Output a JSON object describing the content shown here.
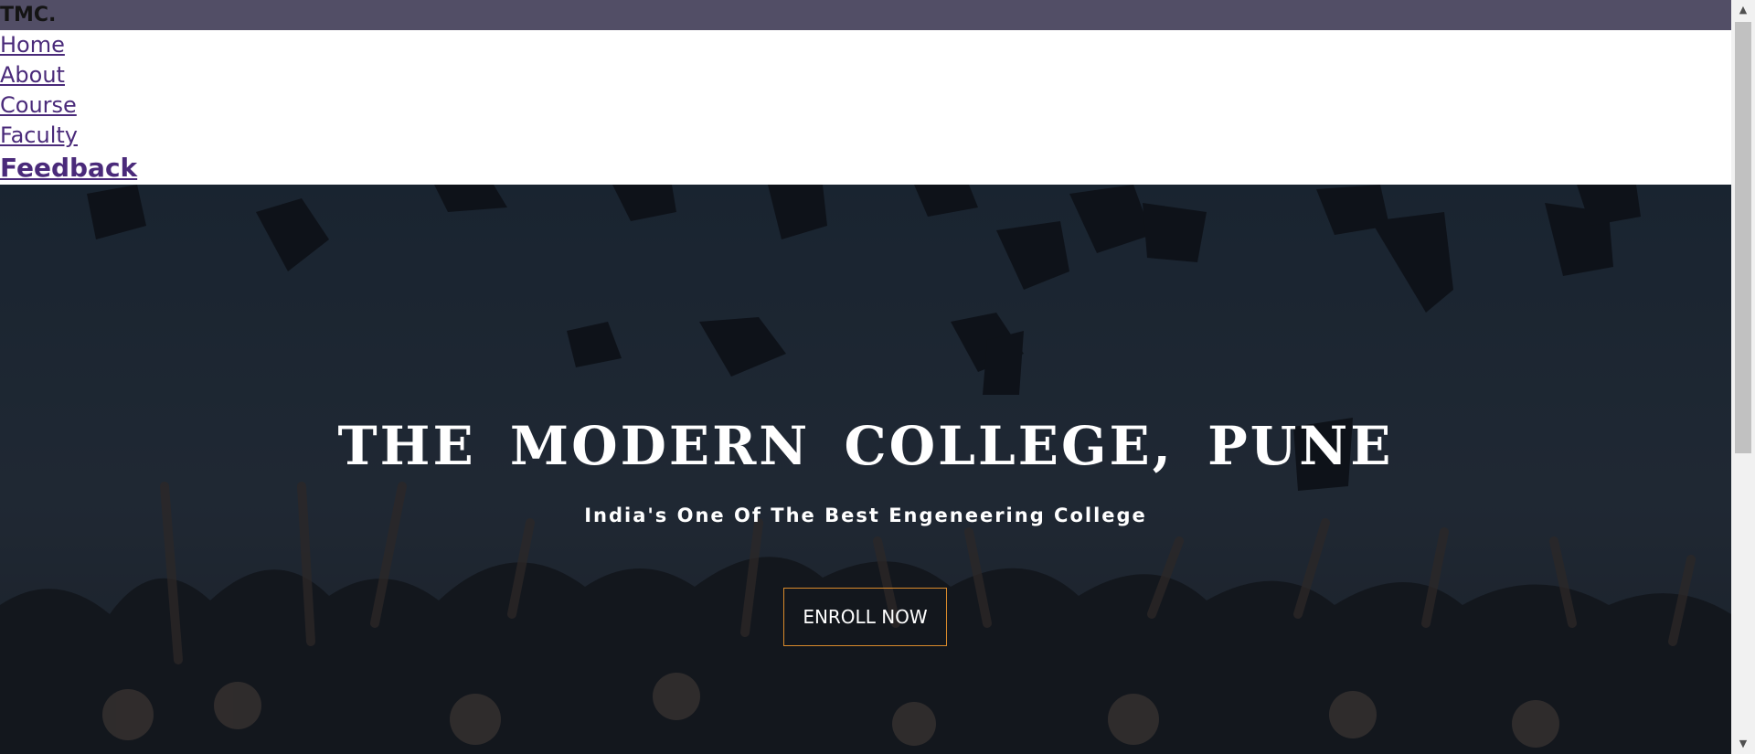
{
  "header": {
    "brand": "TMC."
  },
  "nav": {
    "items": [
      "Home",
      "About",
      "Course",
      "Faculty",
      "Feedback"
    ]
  },
  "hero": {
    "title": "THE MODERN COLLEGE, PUNE",
    "subtitle": "India's One Of The Best Engeneering College",
    "cta_label": "ENROLL NOW",
    "overlay_color": "#1a232e",
    "cta_border_color": "#d98a2b"
  },
  "scrollbar": {
    "up_icon": "▲",
    "down_icon": "▼"
  }
}
